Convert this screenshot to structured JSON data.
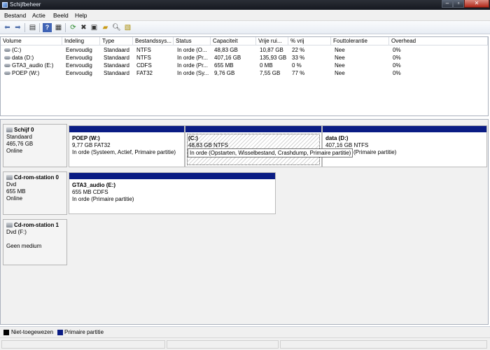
{
  "window": {
    "title": "Schijfbeheer"
  },
  "menu": [
    "Bestand",
    "Actie",
    "Beeld",
    "Help"
  ],
  "toolbar": {
    "buttons": [
      "back-arrow-icon",
      "forward-arrow-icon",
      "show-hide-console-tree-icon",
      "help-icon",
      "view-icon",
      "refresh-icon",
      "delete-icon",
      "properties-icon",
      "open-folder-icon",
      "explore-icon",
      "rescan-icon"
    ]
  },
  "volume_list": {
    "columns": [
      "Volume",
      "Indeling",
      "Type",
      "Bestandssys...",
      "Status",
      "Capaciteit",
      "Vrije rui...",
      "% vrij",
      "Fouttolerantie",
      "Overhead"
    ],
    "rows": [
      [
        "(C:)",
        "Eenvoudig",
        "Standaard",
        "NTFS",
        "In orde (O...",
        "48,83 GB",
        "10,87 GB",
        "22 %",
        "Nee",
        "0%"
      ],
      [
        "data (D:)",
        "Eenvoudig",
        "Standaard",
        "NTFS",
        "In orde (Pr...",
        "407,16 GB",
        "135,93 GB",
        "33 %",
        "Nee",
        "0%"
      ],
      [
        "GTA3_audio (E:)",
        "Eenvoudig",
        "Standaard",
        "CDFS",
        "In orde (Pr...",
        "655 MB",
        "0 MB",
        "0 %",
        "Nee",
        "0%"
      ],
      [
        "POEP (W:)",
        "Eenvoudig",
        "Standaard",
        "FAT32",
        "In orde (Sy...",
        "9,76 GB",
        "7,55 GB",
        "77 %",
        "Nee",
        "0%"
      ]
    ]
  },
  "disks": [
    {
      "name": "Schijf 0",
      "line1": "Standaard",
      "line2": "465,76 GB",
      "line3": "Online",
      "partitions": [
        {
          "title": "POEP  (W:)",
          "size": "9,77 GB FAT32",
          "status": "In orde (Systeem, Actief, Primaire partitie)"
        },
        {
          "title": "(C:)",
          "size": "48,83 GB NTFS",
          "status": ""
        },
        {
          "title": "data  (D:)",
          "size": "407,16 GB NTFS",
          "status": "(Primaire partitie)"
        }
      ]
    },
    {
      "name": "Cd-rom-station 0",
      "line1": "Dvd",
      "line2": "655 MB",
      "line3": "Online",
      "partitions": [
        {
          "title": "GTA3_audio  (E:)",
          "size": "655 MB CDFS",
          "status": "In orde (Primaire partitie)"
        }
      ]
    },
    {
      "name": "Cd-rom-station 1",
      "line1": "Dvd (F:)",
      "line2": "",
      "line3": "Geen medium",
      "partitions": []
    }
  ],
  "tooltip": "In orde (Opstarten, Wisselbestand, Crashdump, Primaire partitie)",
  "legend": [
    {
      "label": "Niet-toegewezen",
      "color": "#000000"
    },
    {
      "label": "Primaire partitie",
      "color": "#0a1c84"
    }
  ]
}
